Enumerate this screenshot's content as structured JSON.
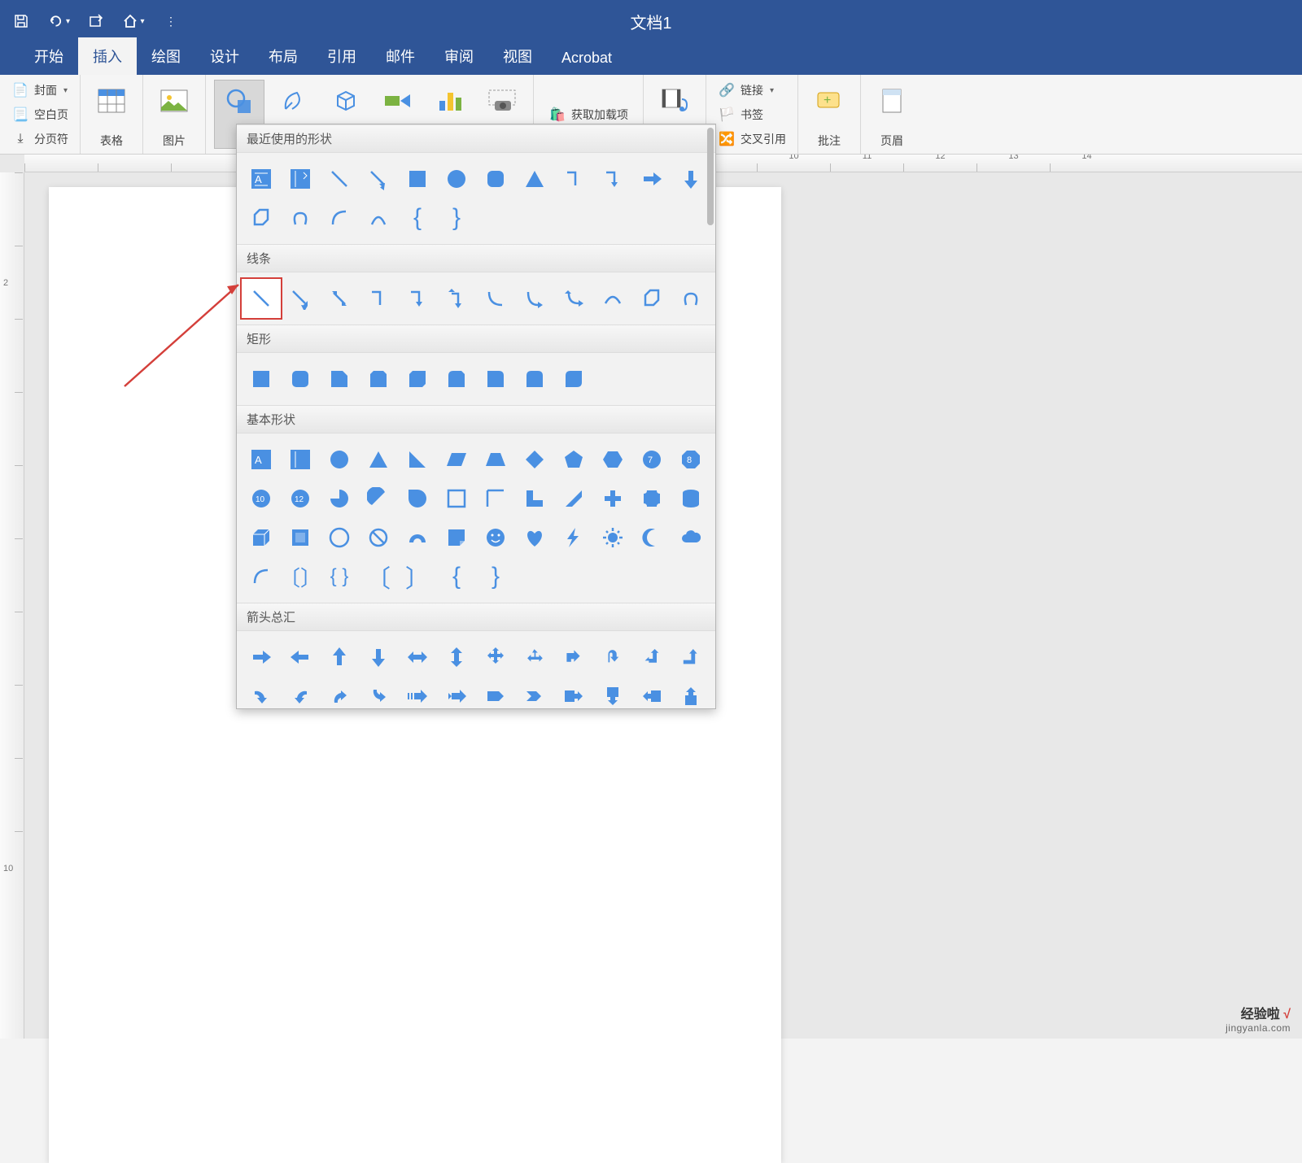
{
  "title": "文档1",
  "qat": {
    "save": "save-icon",
    "undo": "undo-icon",
    "redo": "redo-icon",
    "home": "home-icon",
    "more": "more-icon"
  },
  "tabs": [
    "开始",
    "插入",
    "绘图",
    "设计",
    "布局",
    "引用",
    "邮件",
    "审阅",
    "视图",
    "Acrobat"
  ],
  "active_tab": 1,
  "ribbon": {
    "pages": {
      "cover": "封面",
      "blank": "空白页",
      "break": "分页符"
    },
    "table": "表格",
    "pictures": "图片",
    "addins": "获取加载项",
    "media": "媒体",
    "links": {
      "link": "链接",
      "bookmark": "书签",
      "crossref": "交叉引用"
    },
    "comment": "批注",
    "header": "页眉"
  },
  "shape_categories": {
    "recent": "最近使用的形状",
    "lines": "线条",
    "rects": "矩形",
    "basic": "基本形状",
    "arrows": "箭头总汇"
  },
  "ruler_h": [
    "",
    "",
    "",
    "",
    "",
    "",
    "",
    "",
    "",
    "",
    "10",
    "11",
    "12",
    "13",
    "14"
  ],
  "ruler_v": [
    "",
    "2",
    "",
    "",
    "",
    "",
    "",
    "",
    "",
    "10"
  ],
  "watermark": {
    "brand_a": "经验啦",
    "brand_b": "√",
    "url": "jingyanla.com"
  }
}
